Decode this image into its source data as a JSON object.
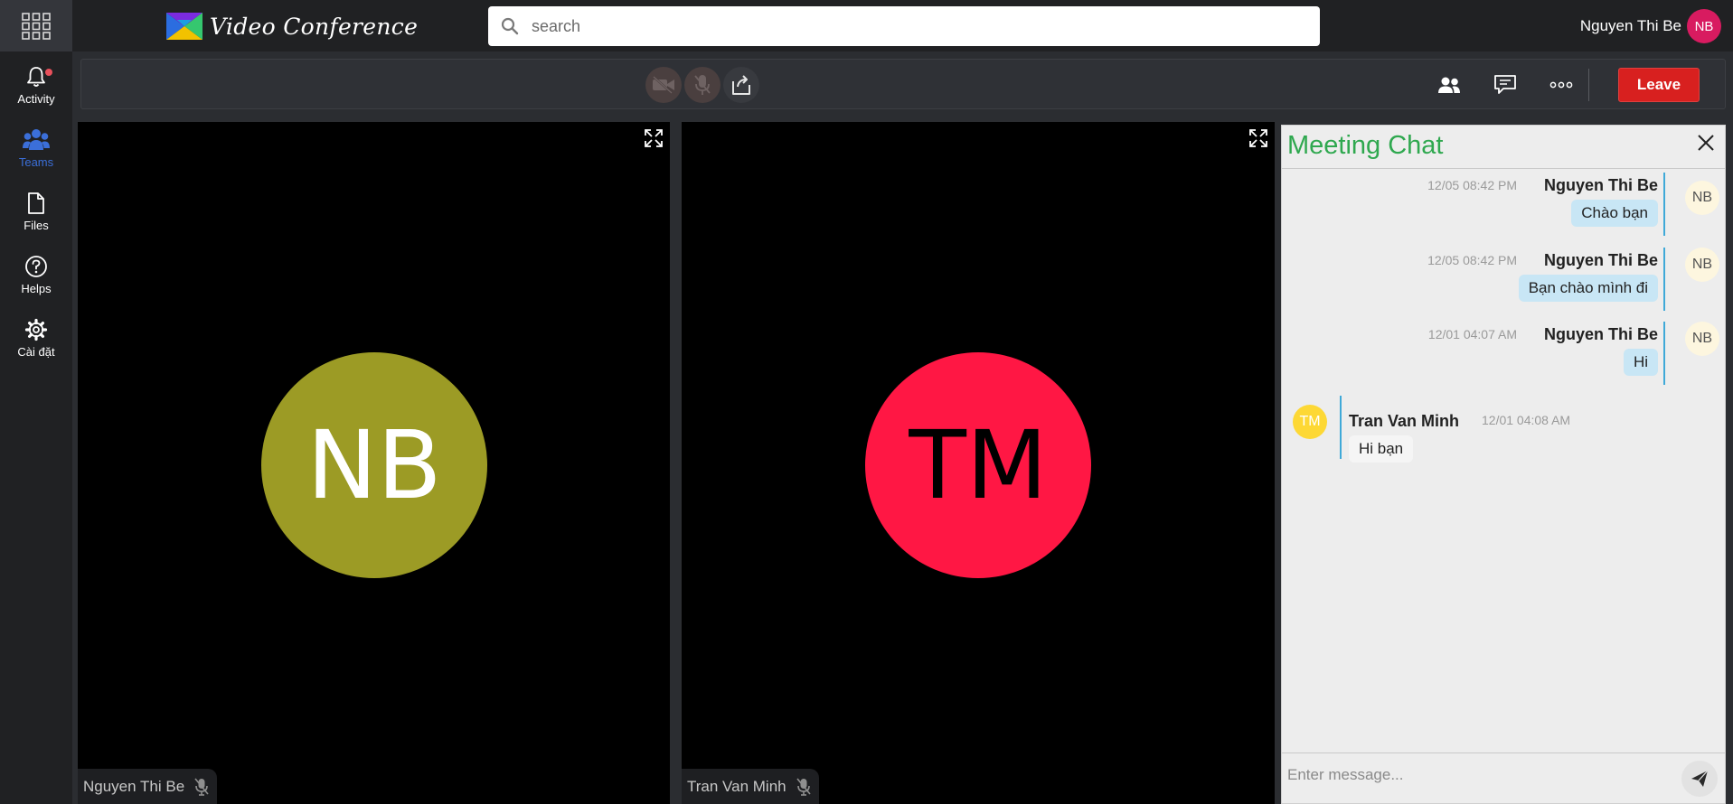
{
  "app": {
    "title": "Video Conference",
    "logo_colors": [
      "#2b6de0",
      "#7b2be0",
      "#35c76f",
      "#f2c200"
    ]
  },
  "search": {
    "placeholder": "search"
  },
  "user": {
    "name": "Nguyen Thi Be",
    "initials": "NB",
    "avatar_color": "#d81b60"
  },
  "sidebar": {
    "items": [
      {
        "label": "Activity",
        "icon": "bell-icon",
        "has_notification": true
      },
      {
        "label": "Teams",
        "icon": "teams-icon",
        "active": true
      },
      {
        "label": "Files",
        "icon": "file-icon"
      },
      {
        "label": "Helps",
        "icon": "help-icon"
      },
      {
        "label": "Cài đặt",
        "icon": "gear-icon"
      }
    ]
  },
  "controls": {
    "camera": {
      "icon": "camera-off-icon",
      "state": "off"
    },
    "mic": {
      "icon": "mic-off-icon",
      "state": "off"
    },
    "share": {
      "icon": "share-screen-icon"
    },
    "participants": {
      "icon": "people-icon"
    },
    "chat": {
      "icon": "chat-icon"
    },
    "more": {
      "icon": "more-icon"
    },
    "leave_label": "Leave",
    "leave_color": "#d8201f"
  },
  "participants": [
    {
      "name": "Nguyen Thi Be",
      "initials": "NB",
      "color": "#9c9b25",
      "text_color": "#ffffff",
      "mic": "muted"
    },
    {
      "name": "Tran Van Minh",
      "initials": "TM",
      "color": "#ff1744",
      "text_color": "#000000",
      "mic": "muted"
    }
  ],
  "chat": {
    "title": "Meeting Chat",
    "input_placeholder": "Enter message...",
    "messages": [
      {
        "sender": "Nguyen Thi Be",
        "initials": "NB",
        "time": "12/05 08:42 PM",
        "text": "Chào bạn",
        "own": true
      },
      {
        "sender": "Nguyen Thi Be",
        "initials": "NB",
        "time": "12/05 08:42 PM",
        "text": "Bạn chào mình đi",
        "own": true
      },
      {
        "sender": "Nguyen Thi Be",
        "initials": "NB",
        "time": "12/01 04:07 AM",
        "text": "Hi",
        "own": true
      },
      {
        "sender": "Tran Van Minh",
        "initials": "TM",
        "time": "12/01 04:08 AM",
        "text": "Hi bạn",
        "own": false
      }
    ]
  }
}
